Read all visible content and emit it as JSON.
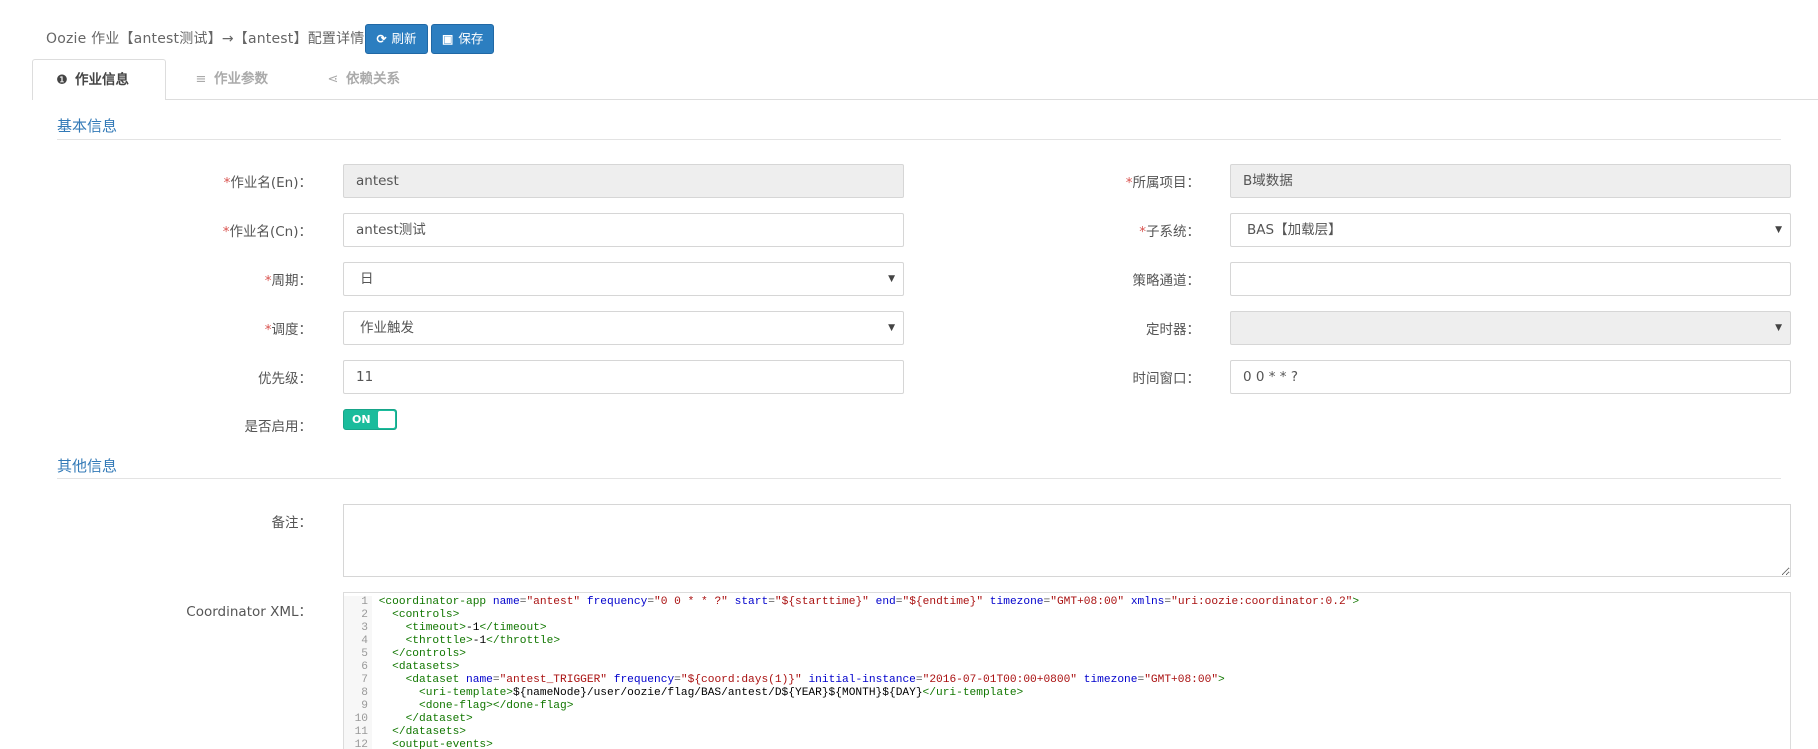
{
  "page": {
    "title": "Oozie 作业【antest测试】→【antest】配置详情",
    "buttons": {
      "refresh": "刷新",
      "save": "保存"
    }
  },
  "tabs": [
    {
      "label": "作业信息",
      "icon": "info-circle-icon",
      "active": true
    },
    {
      "label": "作业参数",
      "icon": "list-icon",
      "active": false
    },
    {
      "label": "依赖关系",
      "icon": "share-icon",
      "active": false
    }
  ],
  "sections": {
    "basic": "基本信息",
    "other": "其他信息"
  },
  "form": {
    "job_name_en": {
      "label": "作业名(En)：",
      "value": "antest",
      "required": true,
      "readonly": true
    },
    "project": {
      "label": "所属项目：",
      "value": "B域数据",
      "required": true,
      "readonly": true
    },
    "job_name_cn": {
      "label": "作业名(Cn)：",
      "value": "antest测试",
      "required": true
    },
    "subsystem": {
      "label": "子系统：",
      "value": "BAS【加载层】",
      "required": true
    },
    "cycle": {
      "label": "周期：",
      "value": "日",
      "required": true
    },
    "strategy_channel": {
      "label": "策略通道：",
      "value": ""
    },
    "schedule": {
      "label": "调度：",
      "value": "作业触发",
      "required": true
    },
    "timer": {
      "label": "定时器：",
      "value": "",
      "readonly": true
    },
    "priority": {
      "label": "优先级：",
      "value": "11"
    },
    "time_window": {
      "label": "时间窗口：",
      "value": "0 0 * * ?"
    },
    "enabled": {
      "label": "是否启用：",
      "state": "ON"
    },
    "remarks": {
      "label": "备注：",
      "value": ""
    },
    "coordinator_xml": {
      "label": "Coordinator XML："
    }
  },
  "colors": {
    "primary": "#2c7ec0",
    "toggle_on": "#1abc9c",
    "required": "#d9534f",
    "section": "#337ab7"
  },
  "code_lines": [
    "<coordinator-app name=\"antest\" frequency=\"0 0 * * ?\" start=\"${starttime}\" end=\"${endtime}\" timezone=\"GMT+08:00\" xmlns=\"uri:oozie:coordinator:0.2\">",
    "  <controls>",
    "    <timeout>-1</timeout>",
    "    <throttle>-1</throttle>",
    "  </controls>",
    "  <datasets>",
    "    <dataset name=\"antest_TRIGGER\" frequency=\"${coord:days(1)}\" initial-instance=\"2016-07-01T00:00+0800\" timezone=\"GMT+08:00\">",
    "      <uri-template>${nameNode}/user/oozie/flag/BAS/antest/D${YEAR}${MONTH}${DAY}</uri-template>",
    "      <done-flag></done-flag>",
    "    </dataset>",
    "  </datasets>",
    "  <output-events>"
  ]
}
